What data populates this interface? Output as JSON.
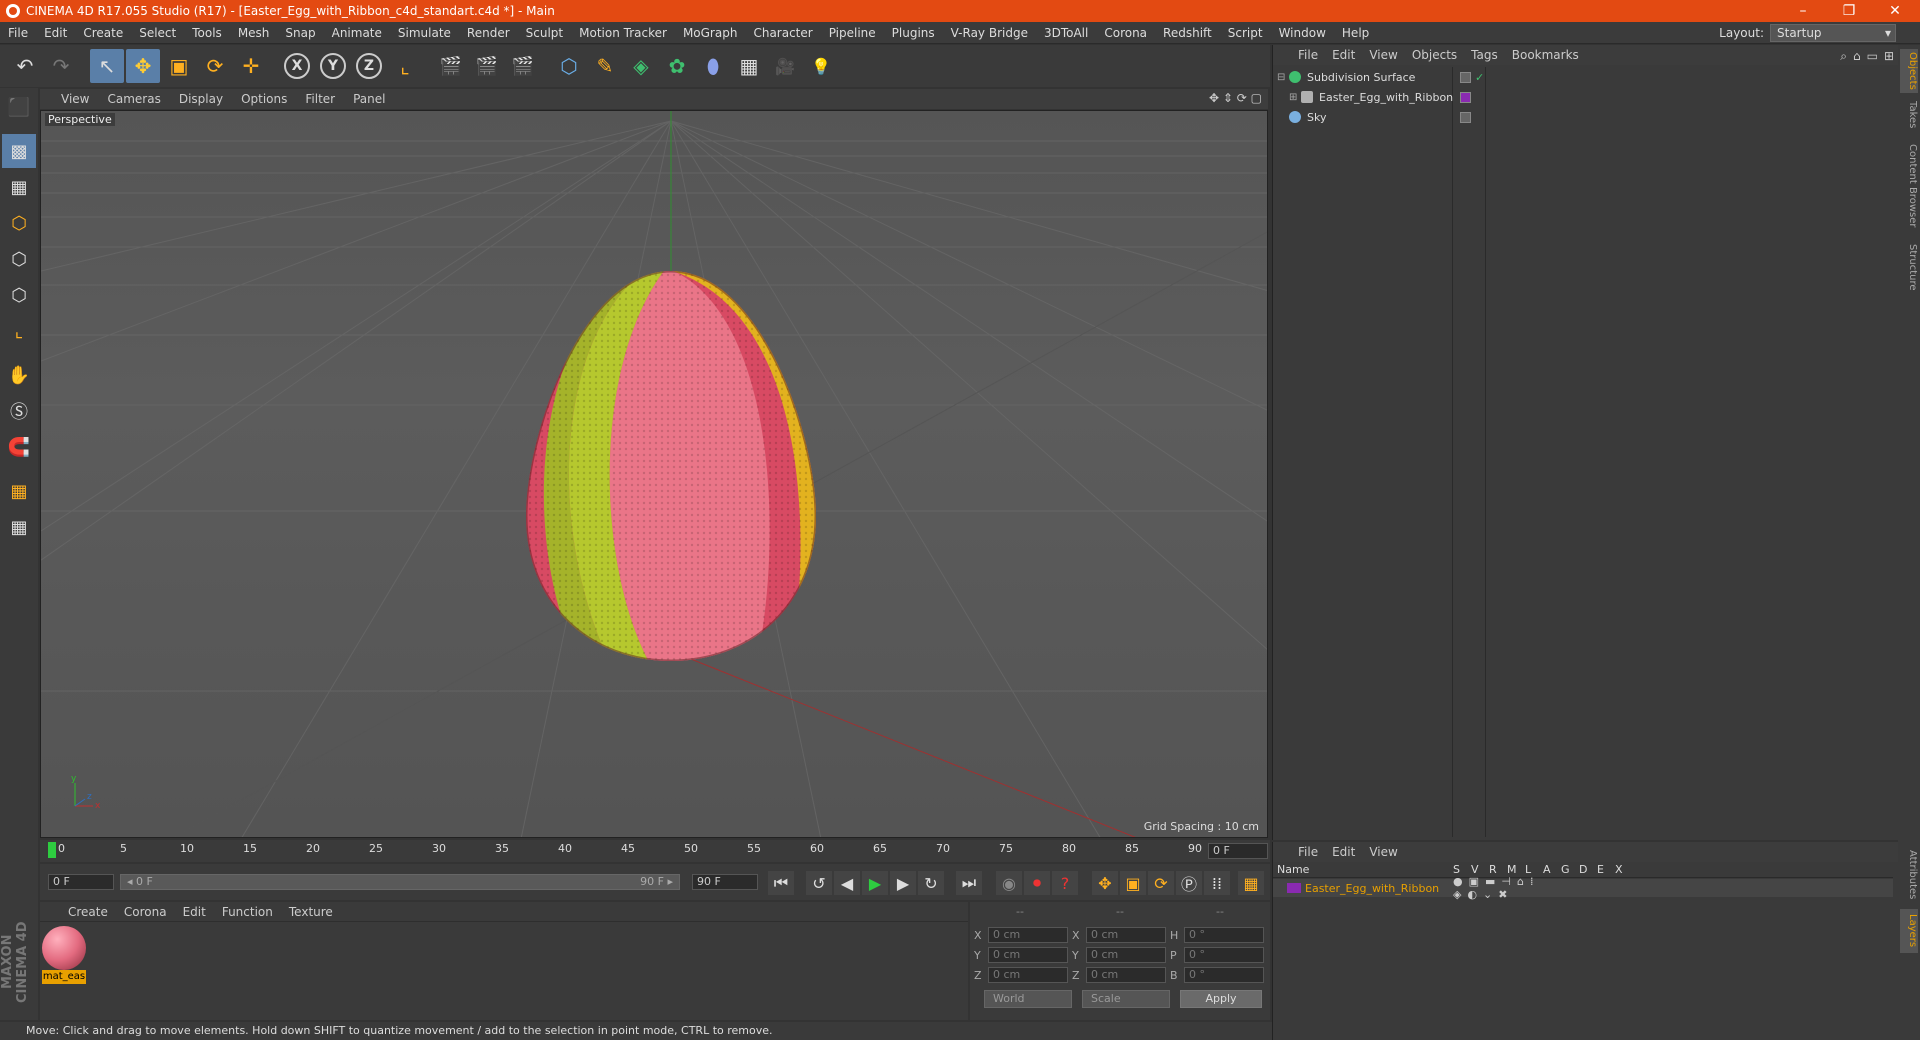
{
  "window": {
    "title": "CINEMA 4D R17.055 Studio (R17) - [Easter_Egg_with_Ribbon_c4d_standart.c4d *] - Main",
    "minimize": "–",
    "restore": "❐",
    "close": "✕"
  },
  "menubar": [
    "File",
    "Edit",
    "Create",
    "Select",
    "Tools",
    "Mesh",
    "Snap",
    "Animate",
    "Simulate",
    "Render",
    "Sculpt",
    "Motion Tracker",
    "MoGraph",
    "Character",
    "Pipeline",
    "Plugins",
    "V-Ray Bridge",
    "3DToAll",
    "Corona",
    "Redshift",
    "Script",
    "Window",
    "Help"
  ],
  "layout": {
    "label": "Layout:",
    "value": "Startup"
  },
  "toolbar": {
    "undo": "↶",
    "redo": "↷",
    "select": "↖",
    "move": "✥",
    "scale": "▣",
    "rotate": "⟳",
    "live": "✛",
    "axis_x": "X",
    "axis_y": "Y",
    "axis_z": "Z",
    "coord": "⌞",
    "render_view": "🎬",
    "render_region": "🎬",
    "render_pv": "🎬",
    "cube": "⬡",
    "pen": "✎",
    "subdiv": "◈",
    "array": "✿",
    "deformer": "⬮",
    "floor": "▦",
    "camera": "🎥",
    "light": "💡"
  },
  "lefttools": [
    "⬛",
    "▩",
    "▦",
    "⬡",
    "⬡",
    "⬡",
    "⌞",
    "✋",
    "Ⓢ",
    "🧲",
    "▦",
    "▦"
  ],
  "viewport": {
    "menu": [
      "View",
      "Cameras",
      "Display",
      "Options",
      "Filter",
      "Panel"
    ],
    "icons": "✥ ⇕ ⟳ ▢",
    "label": "Perspective",
    "grid_spacing": "Grid Spacing : 10 cm"
  },
  "timeline": {
    "ticks": [
      "0",
      "5",
      "10",
      "15",
      "20",
      "25",
      "30",
      "35",
      "40",
      "45",
      "50",
      "55",
      "60",
      "65",
      "70",
      "75",
      "80",
      "85",
      "90"
    ],
    "current": "0 F"
  },
  "playbar": {
    "start": "0 F",
    "slider_start": "◂ 0 F",
    "slider_end": "90 F ▸",
    "end": "90 F"
  },
  "matpanel": {
    "menu": [
      "Create",
      "Corona",
      "Edit",
      "Function",
      "Texture"
    ],
    "material": "mat_eas"
  },
  "coords": {
    "heads": [
      "--",
      "--",
      "--"
    ],
    "rows": [
      {
        "a": "X",
        "av": "0 cm",
        "b": "X",
        "bv": "0 cm",
        "c": "H",
        "cv": "0 °"
      },
      {
        "a": "Y",
        "av": "0 cm",
        "b": "Y",
        "bv": "0 cm",
        "c": "P",
        "cv": "0 °"
      },
      {
        "a": "Z",
        "av": "0 cm",
        "b": "Z",
        "bv": "0 cm",
        "c": "B",
        "cv": "0 °"
      }
    ],
    "world": "World",
    "scale": "Scale",
    "apply": "Apply"
  },
  "status": "Move: Click and drag to move elements. Hold down SHIFT to quantize movement / add to the selection in point mode, CTRL to remove.",
  "objects": {
    "menu": [
      "File",
      "Edit",
      "View",
      "Objects",
      "Tags",
      "Bookmarks"
    ],
    "items": [
      {
        "name": "Subdivision Surface",
        "color": "#3fbf6f"
      },
      {
        "name": "Easter_Egg_with_Ribbon",
        "color": "#b0b0b0"
      },
      {
        "name": "Sky",
        "color": "#7ab0e0"
      }
    ]
  },
  "layers": {
    "menu": [
      "File",
      "Edit",
      "View"
    ],
    "cols": [
      "Name",
      "S",
      "V",
      "R",
      "M",
      "L",
      "A",
      "G",
      "D",
      "E",
      "X"
    ],
    "item": "Easter_Egg_with_Ribbon"
  },
  "sidetabs": [
    "Objects",
    "Takes",
    "Content Browser",
    "Structure",
    "Attributes",
    "Layers"
  ],
  "brand": "MAXON CINEMA 4D"
}
